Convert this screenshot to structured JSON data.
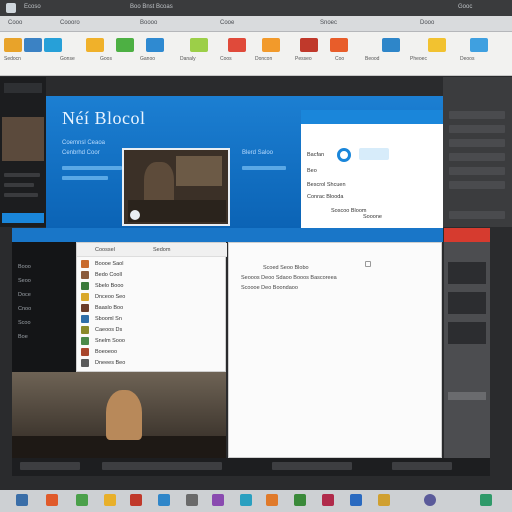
{
  "app": {
    "title_fragments": [
      "Ecoso",
      "Boo Bnst Bcoas",
      "Gooc"
    ],
    "menu_fragments": [
      "Cooo",
      "Coooro",
      "Boooo",
      "Cooe",
      "Snoec",
      "Dooo"
    ]
  },
  "ribbon": {
    "labels": [
      "Sedocn",
      "Gonse",
      "Goos",
      "Ganoo",
      "Danaly",
      "Coos",
      "Doncon",
      "Pesseo",
      "Coo",
      "Beood",
      "Pheoec",
      "Deoos"
    ],
    "colors": [
      "#e8a32a",
      "#3b82c4",
      "#27a0d8",
      "#f0b12a",
      "#4db043",
      "#2f8ad1",
      "#9ccf48",
      "#e04a3a",
      "#f29a2b",
      "#c0392b",
      "#e85d2a",
      "#2e86c9",
      "#f2c230",
      "#3fa0e0"
    ]
  },
  "banner": {
    "title": "Néí Blocol",
    "subtitle_lines": [
      "Coemnsl Ceaoa",
      "Cenbrhd Coor",
      "Blerd Saloo"
    ]
  },
  "dialog": {
    "lines": [
      "Bacfan",
      "Beo",
      "Bescrol Shcuen",
      "Conrac Blooda",
      "Soscoo Bloom",
      "Sooone"
    ]
  },
  "list": {
    "header": [
      "Coossel",
      "Sedom"
    ],
    "rows": [
      "Boooe Saol",
      "Bedo Cooll",
      "Sbelo Booo",
      "Dnceoo Seo",
      "Baaslo Boo",
      "Sbooml Sn",
      "Caeoos Ds",
      "Snelm Sooo",
      "Boeoeoo",
      "Dneees Beo"
    ],
    "thumb_colors": [
      "#c86a2c",
      "#8a5a3a",
      "#3b7a3b",
      "#d9a82a",
      "#6a3c2a",
      "#2f6ea8",
      "#8a8a2a",
      "#4a8a4a",
      "#a8462c",
      "#5a5a5a"
    ]
  },
  "document": {
    "lines": [
      "Scoed Seoo Blobo",
      "Seooos Deoo Sdaoo Booos Bascoreea",
      "Scoooe Deo Boondaoo"
    ]
  },
  "sidebar": {
    "items": [
      "Booo",
      "Seoo",
      "Doce",
      "Cnoo",
      "Scoo",
      "Boe"
    ]
  },
  "taskbar": {
    "colors": [
      "#3a6ea8",
      "#e05a2a",
      "#4aa04a",
      "#e8b02a",
      "#c0392b",
      "#2f86c9",
      "#6a6a6a",
      "#8a4ab0",
      "#2aa0c0",
      "#e07a2a",
      "#3a8a3a",
      "#b02a4a",
      "#2a6ac0",
      "#d0a030",
      "#5a5a9a",
      "#2f9a6a"
    ]
  }
}
